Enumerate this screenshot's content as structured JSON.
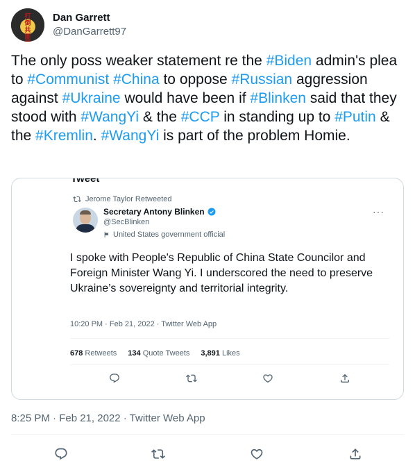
{
  "author": {
    "name": "Dan Garrett",
    "handle": "@DanGarrett97",
    "avatar_glyphs": "打倒共匪黨"
  },
  "tweet": {
    "segments": [
      {
        "text": "The only poss weaker statement re the ",
        "tag": false
      },
      {
        "text": "#Biden",
        "tag": true
      },
      {
        "text": " admin's plea to ",
        "tag": false
      },
      {
        "text": "#Communist",
        "tag": true
      },
      {
        "text": " ",
        "tag": false
      },
      {
        "text": "#China",
        "tag": true
      },
      {
        "text": " to oppose ",
        "tag": false
      },
      {
        "text": "#Russian",
        "tag": true
      },
      {
        "text": " aggression against ",
        "tag": false
      },
      {
        "text": "#Ukraine",
        "tag": true
      },
      {
        "text": " would have been if ",
        "tag": false
      },
      {
        "text": "#Blinken",
        "tag": true
      },
      {
        "text": " said that they stood with ",
        "tag": false
      },
      {
        "text": "#WangYi",
        "tag": true
      },
      {
        "text": " & the ",
        "tag": false
      },
      {
        "text": "#CCP",
        "tag": true
      },
      {
        "text": " in standing up to ",
        "tag": false
      },
      {
        "text": "#Putin",
        "tag": true
      },
      {
        "text": " & the ",
        "tag": false
      },
      {
        "text": "#Kremlin",
        "tag": true
      },
      {
        "text": ". ",
        "tag": false
      },
      {
        "text": "#WangYi",
        "tag": true
      },
      {
        "text": " is part of the problem Homie.",
        "tag": false
      }
    ],
    "timestamp": "8:25 PM · Feb 21, 2022 · Twitter Web App"
  },
  "quote": {
    "top_cut_text": "Tweet",
    "retweeted_by": "Jerome Taylor Retweeted",
    "name": "Secretary Antony Blinken",
    "handle": "@SecBlinken",
    "label": "United States government official",
    "body": "I spoke with People's Republic of China State Councilor and Foreign Minister Wang Yi. I underscored the need to preserve Ukraine’s sovereignty and territorial integrity.",
    "meta": "10:20 PM · Feb 21, 2022 · Twitter Web App",
    "retweets_count": "678",
    "retweets_label": "Retweets",
    "quotes_count": "134",
    "quotes_label": "Quote Tweets",
    "likes_count": "3,891",
    "likes_label": "Likes"
  },
  "icons": {
    "reply": "reply-icon",
    "retweet": "retweet-icon",
    "like": "like-icon",
    "share": "share-icon"
  },
  "colors": {
    "accent": "#1d9bf0",
    "text": "#0f1419",
    "secondary": "#536471",
    "border": "#cfd9de"
  }
}
